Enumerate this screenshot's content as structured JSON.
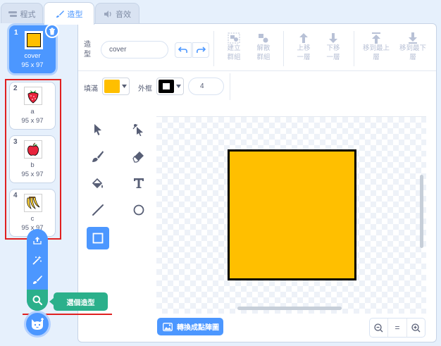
{
  "tabs": [
    {
      "label": "程式",
      "icon": "code-icon"
    },
    {
      "label": "造型",
      "icon": "brush-icon"
    },
    {
      "label": "音效",
      "icon": "speaker-icon"
    }
  ],
  "costumes": [
    {
      "number": "1",
      "name": "cover",
      "size": "95 x 97",
      "thumbnail": "yellow-square",
      "selected": true
    },
    {
      "number": "2",
      "name": "a",
      "size": "95 x 97",
      "thumbnail": "strawberry"
    },
    {
      "number": "3",
      "name": "b",
      "size": "95 x 97",
      "thumbnail": "apple"
    },
    {
      "number": "4",
      "name": "c",
      "size": "95 x 97",
      "thumbnail": "bananas"
    }
  ],
  "editor": {
    "costume_label": "造型",
    "costume_name": "cover",
    "toolbar": {
      "group": "建立群組",
      "ungroup": "解散群組",
      "forward": "上移一層",
      "backward": "下移一層",
      "front": "移到最上層",
      "back": "移到最下層"
    },
    "fill_label": "填滿",
    "outline_label": "外框",
    "outline_width": "4",
    "fill_color": "#ffbf00",
    "outline_color": "#000000",
    "convert_button": "轉換成點陣圖",
    "zoom_reset": "="
  },
  "add_menu": {
    "tooltip": "選個造型",
    "items": [
      "upload-icon",
      "surprise-icon",
      "paint-icon",
      "search-icon"
    ]
  },
  "colors": {
    "accent": "#4c97ff",
    "highlight": "#2bb08b",
    "annotation": "#e02020"
  }
}
